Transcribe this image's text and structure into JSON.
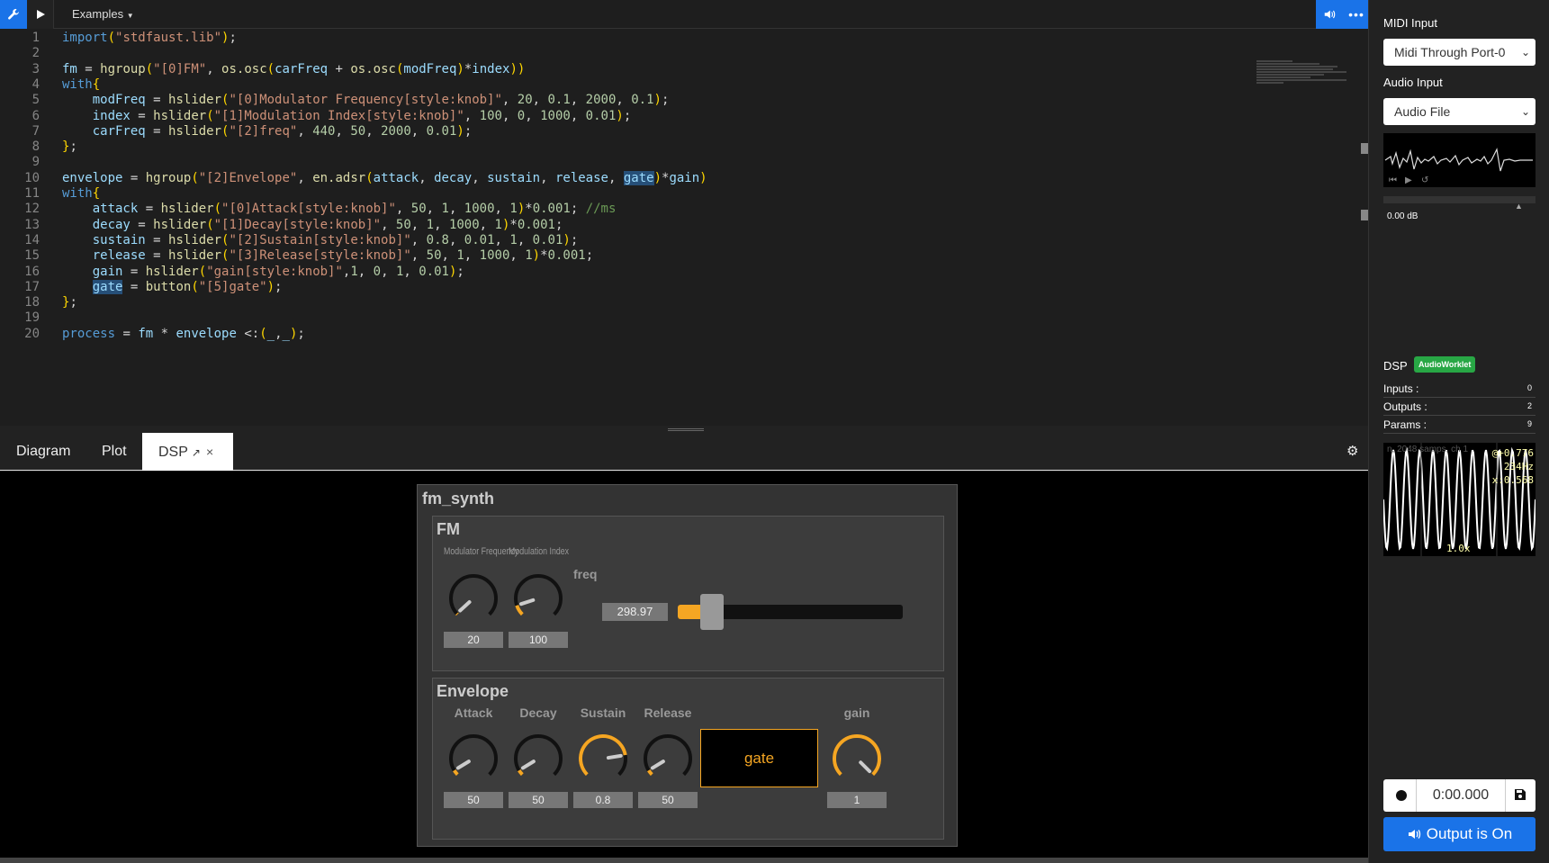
{
  "toolbar": {
    "examples_label": "Examples"
  },
  "editor": {
    "lines": [
      {
        "n": "1"
      },
      {
        "n": "2"
      },
      {
        "n": "3"
      },
      {
        "n": "4"
      },
      {
        "n": "5"
      },
      {
        "n": "6"
      },
      {
        "n": "7"
      },
      {
        "n": "8"
      },
      {
        "n": "9"
      },
      {
        "n": "10"
      },
      {
        "n": "11"
      },
      {
        "n": "12"
      },
      {
        "n": "13"
      },
      {
        "n": "14"
      },
      {
        "n": "15"
      },
      {
        "n": "16"
      },
      {
        "n": "17"
      },
      {
        "n": "18"
      },
      {
        "n": "19"
      },
      {
        "n": "20"
      }
    ],
    "code": {
      "l1a": "import",
      "l1b": "(",
      "l1c": "\"stdfaust.lib\"",
      "l1d": ");",
      "l3": "fm = hgroup(\"[0]FM\", os.osc(carFreq + os.osc(modFreq)*index))",
      "l4": "with{",
      "l5": "    modFreq = hslider(\"[0]Modulator Frequency[style:knob]\", 20, 0.1, 2000, 0.1);",
      "l6": "    index = hslider(\"[1]Modulation Index[style:knob]\", 100, 0, 1000, 0.01);",
      "l7": "    carFreq = hslider(\"[2]freq\", 440, 50, 2000, 0.01);",
      "l8": "};",
      "l10": "envelope = hgroup(\"[2]Envelope\", en.adsr(attack, decay, sustain, release, gate)*gain)",
      "l11": "with{",
      "l12": "    attack = hslider(\"[0]Attack[style:knob]\", 50, 1, 1000, 1)*0.001; //ms",
      "l13": "    decay = hslider(\"[1]Decay[style:knob]\", 50, 1, 1000, 1)*0.001;",
      "l14": "    sustain = hslider(\"[2]Sustain[style:knob]\", 0.8, 0.01, 1, 0.01);",
      "l15": "    release = hslider(\"[3]Release[style:knob]\", 50, 1, 1000, 1)*0.001;",
      "l16": "    gain = hslider(\"gain[style:knob]\",1, 0, 1, 0.01);",
      "l17": "    gate = button(\"[5]gate\");",
      "l18": "};",
      "l20": "process = fm * envelope <:(_,_);"
    }
  },
  "tabs": {
    "diagram": "Diagram",
    "plot": "Plot",
    "dsp": "DSP",
    "close": "×"
  },
  "ui": {
    "root_title": "fm_synth",
    "fm": {
      "title": "FM",
      "mod_freq_label": "Modulator Frequency",
      "mod_freq_value": "20",
      "mod_freq_level": 0.01,
      "mod_index_label": "Modulation Index",
      "mod_index_value": "100",
      "mod_index_level": 0.1,
      "freq_label": "freq",
      "freq_value": "298.97",
      "freq_level": 0.13
    },
    "envelope": {
      "title": "Envelope",
      "attack_label": "Attack",
      "attack_value": "50",
      "attack_level": 0.05,
      "decay_label": "Decay",
      "decay_value": "50",
      "decay_level": 0.05,
      "sustain_label": "Sustain",
      "sustain_value": "0.8",
      "sustain_level": 0.8,
      "release_label": "Release",
      "release_value": "50",
      "release_level": 0.05,
      "gate_label": "gate",
      "gain_label": "gain",
      "gain_value": "1",
      "gain_level": 1.0
    }
  },
  "sidebar": {
    "midi_input_label": "MIDI Input",
    "midi_input_value": "Midi Through Port-0",
    "audio_input_label": "Audio Input",
    "audio_input_value": "Audio File",
    "volume_text": "0.00 dB",
    "dsp_label": "DSP",
    "dsp_badge": "AudioWorklet",
    "inputs_label": "Inputs :",
    "inputs_value": "0",
    "outputs_label": "Outputs :",
    "outputs_value": "2",
    "params_label": "Params :",
    "params_value": "9",
    "scope_samps": "n, 2048 samps, ch 1",
    "scope_amp": "@+0.776",
    "scope_freq": "234Hz",
    "scope_x": "x:0.568",
    "scope_zoom": "1.0x",
    "rec_time": "0:00.000",
    "output_label": "Output is On"
  },
  "colors": {
    "accent": "#1a73e8",
    "knob_active": "#f5a623",
    "badge": "#28a745"
  }
}
